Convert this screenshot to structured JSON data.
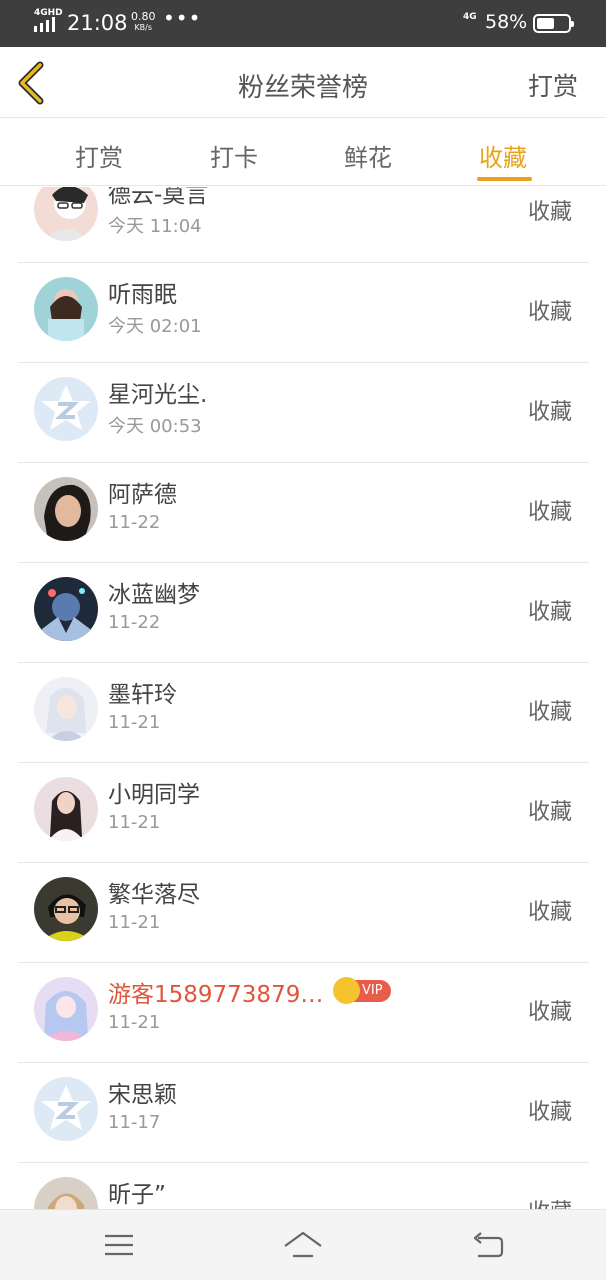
{
  "status_bar": {
    "network": "4GHD",
    "time": "21:08",
    "speed_value": "0.80",
    "speed_unit": "KB/s",
    "more": "•••",
    "network2": "4G",
    "battery": "58%",
    "battery_level": 0.58
  },
  "header": {
    "back_icon": "chevron-left-icon",
    "title": "粉丝荣誉榜",
    "action": "打赏"
  },
  "tabs": [
    {
      "label": "打赏",
      "active": false
    },
    {
      "label": "打卡",
      "active": false
    },
    {
      "label": "鲜花",
      "active": false
    },
    {
      "label": "收藏",
      "active": true
    }
  ],
  "accent_color": "#e8a21c",
  "list": [
    {
      "name": "德云-莫言",
      "time": "今天 11:04",
      "action": "收藏"
    },
    {
      "name": "听雨眠",
      "time": "今天 02:01",
      "action": "收藏"
    },
    {
      "name": "星河光尘.",
      "time": "今天 00:53",
      "action": "收藏"
    },
    {
      "name": "阿萨德",
      "time": "11-22",
      "action": "收藏"
    },
    {
      "name": "冰蓝幽梦",
      "time": "11-22",
      "action": "收藏"
    },
    {
      "name": "墨轩玲",
      "time": "11-21",
      "action": "收藏"
    },
    {
      "name": "小明同学",
      "time": "11-21",
      "action": "收藏"
    },
    {
      "name": "繁华落尽",
      "time": "11-21",
      "action": "收藏"
    },
    {
      "name": "游客1589773879…",
      "time": "11-21",
      "action": "收藏",
      "badge": "VIP"
    },
    {
      "name": "宋思颖",
      "time": "11-17",
      "action": "收藏"
    },
    {
      "name": "昕子”",
      "time": "",
      "action": "收藏"
    }
  ],
  "nav": {
    "menu_icon": "menu-icon",
    "home_icon": "home-icon",
    "back_icon": "back-arrow-icon"
  }
}
